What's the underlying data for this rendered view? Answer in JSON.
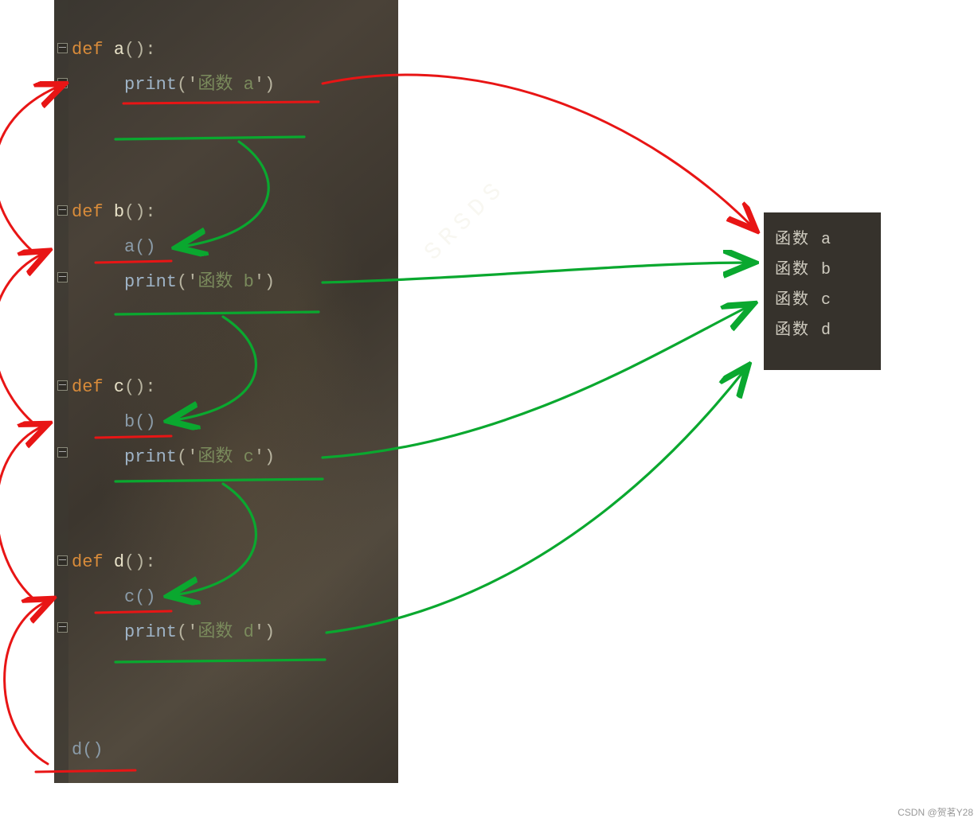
{
  "functions": {
    "a": {
      "def": "def ",
      "name": "a",
      "sig": "():",
      "body_call": "",
      "print_pre": "print",
      "print_open": "('",
      "print_arg": "函数 a",
      "print_close": "')"
    },
    "b": {
      "def": "def ",
      "name": "b",
      "sig": "():",
      "body_call": "a()",
      "print_pre": "print",
      "print_open": "('",
      "print_arg": "函数 b",
      "print_close": "')"
    },
    "c": {
      "def": "def ",
      "name": "c",
      "sig": "():",
      "body_call": "b()",
      "print_pre": "print",
      "print_open": "('",
      "print_arg": "函数 c",
      "print_close": "')"
    },
    "d": {
      "def": "def ",
      "name": "d",
      "sig": "():",
      "body_call": "c()",
      "print_pre": "print",
      "print_open": "('",
      "print_arg": "函数 d",
      "print_close": "')"
    }
  },
  "entry_call": "d()",
  "output": {
    "line1": "函数 a",
    "line2": "函数 b",
    "line3": "函数 c",
    "line4": "函数 d"
  },
  "watermark_hidden": "SRSDS",
  "watermark_footer": "CSDN @贺茗Y28"
}
